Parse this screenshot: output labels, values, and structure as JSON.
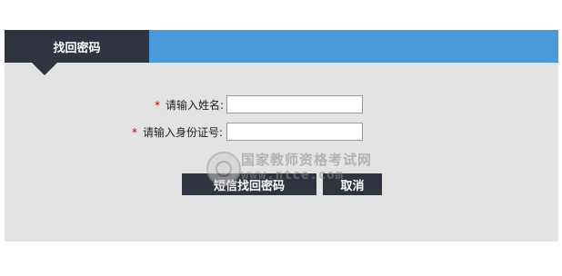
{
  "header": {
    "tab_title": "找回密码"
  },
  "form": {
    "name_label": "请输入姓名:",
    "name_value": "",
    "id_label": "请输入身份证号:",
    "id_value": "",
    "required_mark": "*"
  },
  "actions": {
    "sms_button": "短信找回密码",
    "cancel_button": "取消"
  },
  "watermark": {
    "title": "国家教师资格考试网",
    "url": "www.ntce.com"
  },
  "colors": {
    "header_blue": "#4a99da",
    "dark": "#2f3440",
    "panel_bg": "#e3e3e3",
    "required": "#c00000"
  }
}
